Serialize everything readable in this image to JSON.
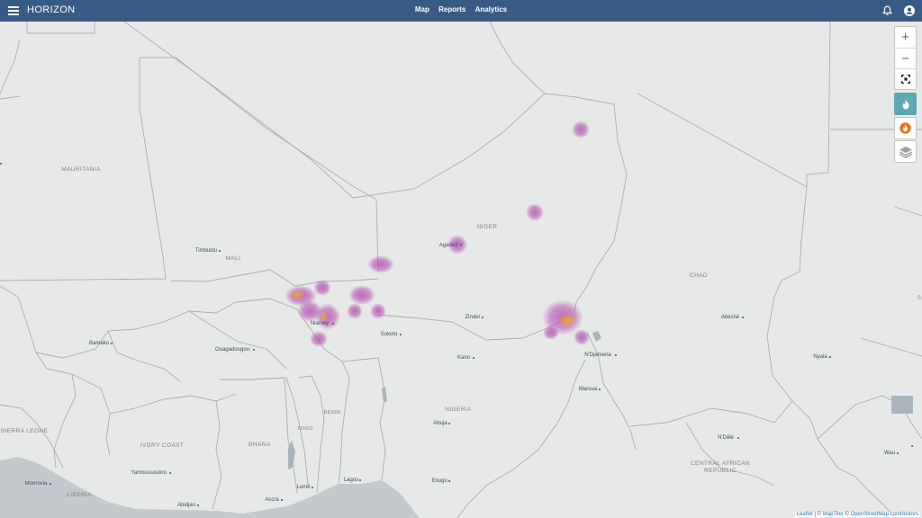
{
  "app": {
    "title": "HORIZON"
  },
  "nav": {
    "items": [
      "Map",
      "Reports",
      "Analytics"
    ]
  },
  "icons": {
    "menu": "hamburger-menu-icon",
    "notifications": "bell-icon",
    "account": "user-circle-icon"
  },
  "map_controls": {
    "zoom_in": "+",
    "zoom_out": "−",
    "fullscreen": "fullscreen-icon",
    "heatmap": "flame-icon",
    "fire_layer": "fire-icon",
    "layers": "layers-icon"
  },
  "colors": {
    "header": "#3a5a86",
    "heatmap_active": "#5ea8b3",
    "fire_icon": "#e8731c"
  },
  "countries": [
    {
      "key": "mauritania",
      "label": "MAURITANIA"
    },
    {
      "key": "mali",
      "label": "MALI"
    },
    {
      "key": "niger",
      "label": "NIGER"
    },
    {
      "key": "chad",
      "label": "CHAD"
    },
    {
      "key": "benin",
      "label": "BENIN"
    },
    {
      "key": "togo",
      "label": "TOGO"
    },
    {
      "key": "nigeria",
      "label": "NIGERIA"
    },
    {
      "key": "ghana",
      "label": "GHANA"
    },
    {
      "key": "ivory_coast",
      "label": "IVORY COAST"
    },
    {
      "key": "sierra_leone",
      "label": "SIERRA LEONE"
    },
    {
      "key": "liberia",
      "label": "LIBERIA"
    },
    {
      "key": "car1",
      "label": "CENTRAL AFRICAN"
    },
    {
      "key": "car2",
      "label": "REPUBLIC"
    },
    {
      "key": "edge_s",
      "label": "S"
    }
  ],
  "cities": [
    {
      "key": "timbuktu",
      "label": "Timbuktu"
    },
    {
      "key": "agadez",
      "label": "Agadez"
    },
    {
      "key": "niamey",
      "label": "Niamey"
    },
    {
      "key": "zinder",
      "label": "Zinder"
    },
    {
      "key": "sokoto",
      "label": "Sokoto"
    },
    {
      "key": "abeche",
      "label": "Abéché"
    },
    {
      "key": "bamako",
      "label": "Bamako"
    },
    {
      "key": "ouagadougou",
      "label": "Ouagadougou"
    },
    {
      "key": "kano",
      "label": "Kano"
    },
    {
      "key": "ndjamena",
      "label": "N'Djamena"
    },
    {
      "key": "nyala",
      "label": "Nyala"
    },
    {
      "key": "maroua",
      "label": "Maroua"
    },
    {
      "key": "abuja",
      "label": "Abuja"
    },
    {
      "key": "ndele",
      "label": "N'Délé"
    },
    {
      "key": "yamoussoukro",
      "label": "Yamoussoukro"
    },
    {
      "key": "monrovia",
      "label": "Monrovia"
    },
    {
      "key": "abidjan",
      "label": "Abidjan"
    },
    {
      "key": "accra",
      "label": "Accra"
    },
    {
      "key": "lome",
      "label": "Lomé"
    },
    {
      "key": "lagos",
      "label": "Lagos"
    },
    {
      "key": "enugu",
      "label": "Enugu"
    },
    {
      "key": "wau",
      "label": "Wau"
    }
  ],
  "attribution": {
    "leaflet": "Leaflet",
    "sep1": " | © ",
    "maptiler": "MapTiler",
    "sep2": " © ",
    "osm": "OpenStreetMap contributors"
  }
}
